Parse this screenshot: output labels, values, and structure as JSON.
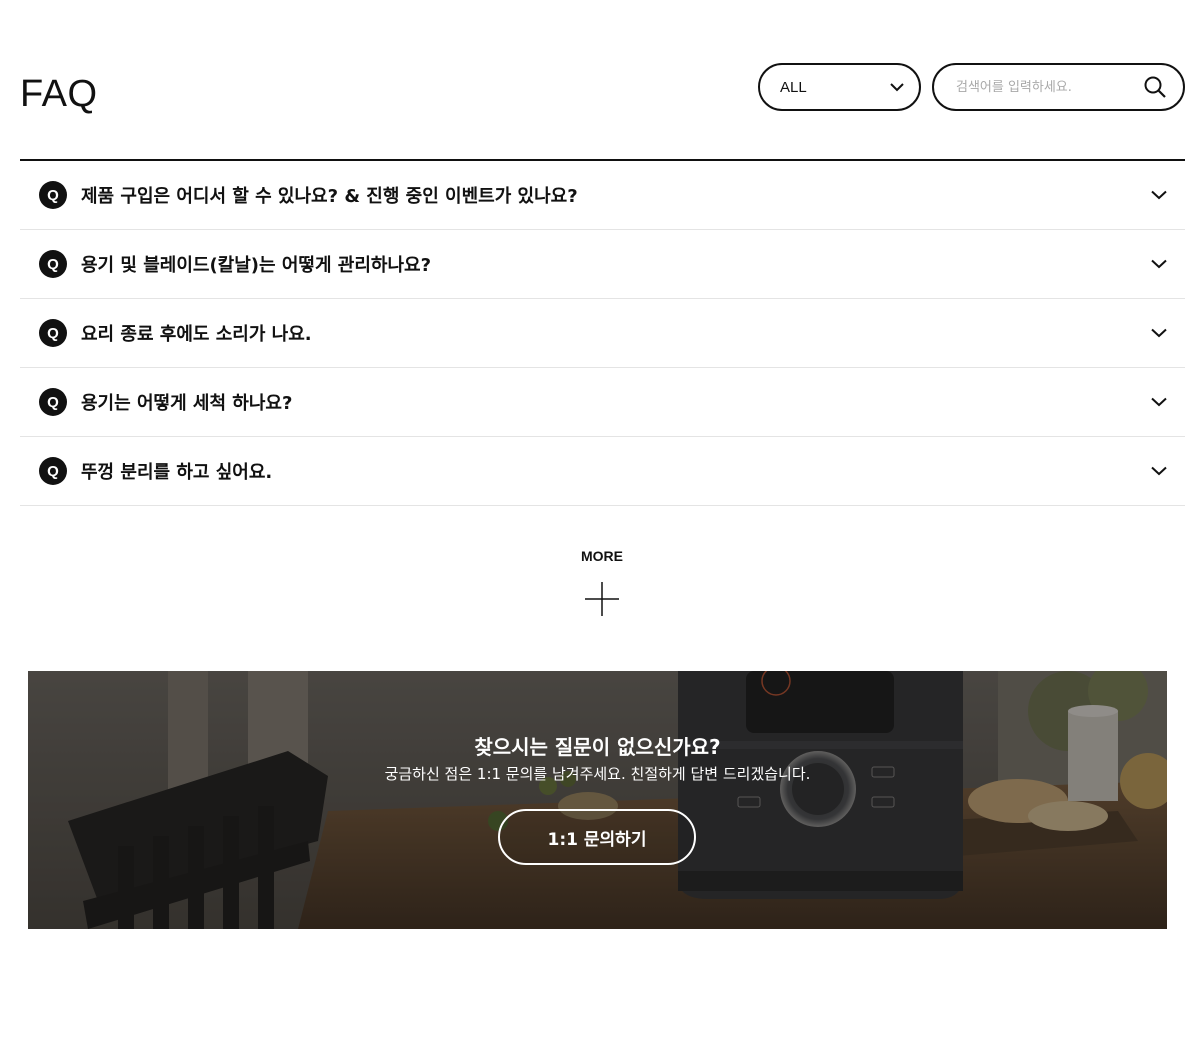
{
  "header": {
    "title": "FAQ",
    "category_select": {
      "value": "ALL"
    },
    "search": {
      "placeholder": "검색어를 입력하세요.",
      "value": ""
    }
  },
  "faq": {
    "items": [
      {
        "badge": "Q",
        "question": "제품 구입은 어디서 할 수 있나요? & 진행 중인 이벤트가 있나요?"
      },
      {
        "badge": "Q",
        "question": "용기 및 블레이드(칼날)는 어떻게 관리하나요?"
      },
      {
        "badge": "Q",
        "question": "요리 종료 후에도 소리가 나요."
      },
      {
        "badge": "Q",
        "question": "용기는 어떻게 세척 하나요?"
      },
      {
        "badge": "Q",
        "question": "뚜껑 분리를 하고 싶어요."
      }
    ]
  },
  "more": {
    "label": "MORE"
  },
  "banner": {
    "heading": "찾으시는 질문이 없으신가요?",
    "description": "궁금하신 점은 1:1 문의를 남겨주세요. 친절하게 답변 드리겠습니다.",
    "button_label": "1:1 문의하기"
  },
  "icons": {
    "select_arrow": "chevron-down-icon",
    "search": "search-icon",
    "faq_toggle": "chevron-down-icon",
    "more": "plus-icon"
  },
  "colors": {
    "text": "#111111",
    "divider": "#e4e4e4",
    "placeholder": "#a9a9a9",
    "banner_overlay": "#2b2a28"
  }
}
